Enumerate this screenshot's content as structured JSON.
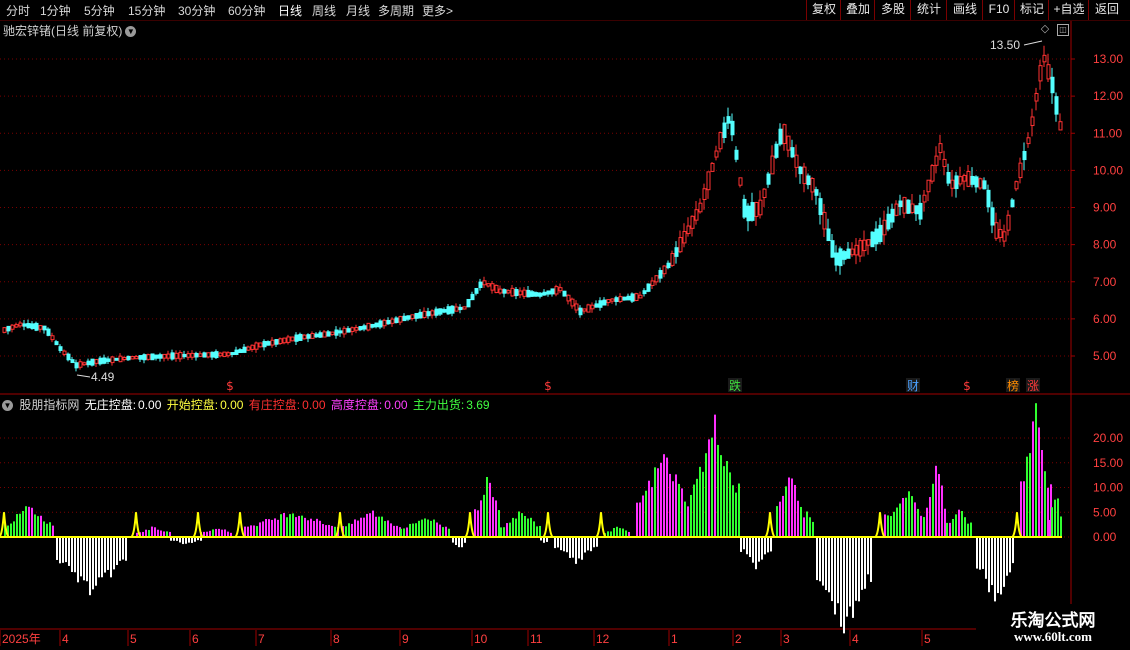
{
  "toolbar": {
    "periods": [
      "分时",
      "1分钟",
      "5分钟",
      "15分钟",
      "30分钟",
      "60分钟",
      "日线",
      "周线",
      "月线",
      "多周期",
      "更多"
    ],
    "active_period": "日线",
    "more_arrow": ">",
    "right_buttons": [
      "复权",
      "叠加",
      "多股",
      "统计",
      "画线",
      "F10",
      "标记",
      "+自选",
      "返回"
    ]
  },
  "stock": {
    "title": "驰宏锌锗(日线 前复权)",
    "max_label": "13.50",
    "min_label": "4.49"
  },
  "price_axis": [
    "13.00",
    "12.00",
    "11.00",
    "10.00",
    "9.00",
    "8.00",
    "7.00",
    "6.00",
    "5.00"
  ],
  "event_markers": [
    {
      "text": "$",
      "color": "#ff3b3b"
    },
    {
      "text": "$",
      "color": "#ff3b3b"
    },
    {
      "text": "跌",
      "color": "#40e040"
    },
    {
      "text": "财",
      "color": "#4aa0ff"
    },
    {
      "text": "$",
      "color": "#ff3b3b"
    },
    {
      "text": "榜",
      "color": "#ff8c00"
    },
    {
      "text": "涨",
      "color": "#ff3b3b"
    }
  ],
  "indicator": {
    "name": "股朋指标网",
    "items": [
      {
        "label": "无庄控盘:",
        "value": "0.00",
        "color": "#ffffff"
      },
      {
        "label": "开始控盘:",
        "value": "0.00",
        "color": "#ffff40"
      },
      {
        "label": "有庄控盘:",
        "value": "0.00",
        "color": "#ff3030"
      },
      {
        "label": "高度控盘:",
        "value": "0.00",
        "color": "#ff40ff"
      },
      {
        "label": "主力出货:",
        "value": "3.69",
        "color": "#40ff40"
      }
    ],
    "axis": [
      "20.00",
      "15.00",
      "10.00",
      "5.00",
      "0.00"
    ]
  },
  "date_axis": [
    "2025年",
    "4",
    "5",
    "6",
    "7",
    "8",
    "9",
    "10",
    "11",
    "12",
    "1",
    "2",
    "3",
    "4",
    "5"
  ],
  "watermark": {
    "line1": "乐淘公式网",
    "line2": "www.60lt.com"
  },
  "colors": {
    "up": "#ff3232",
    "down": "#54ffff",
    "grid": "#7a0000",
    "axis": "#a00000",
    "magenta": "#ff30ff",
    "green": "#30ff30",
    "yellow": "#ffff00",
    "white": "#ffffff"
  }
}
